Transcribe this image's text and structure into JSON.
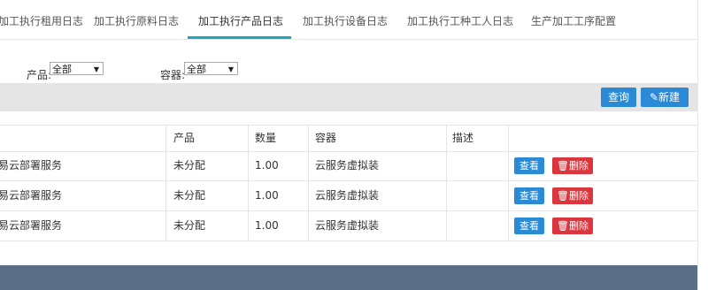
{
  "tabs": [
    {
      "label": "加工执行租用日志"
    },
    {
      "label": "加工执行原料日志"
    },
    {
      "label": "加工执行产品日志"
    },
    {
      "label": "加工执行设备日志"
    },
    {
      "label": "加工执行工种工人日志"
    },
    {
      "label": "生产加工工序配置"
    }
  ],
  "active_tab": "加工执行产品日志",
  "filters": {
    "product_label": "产品:",
    "product_value": "全部",
    "container_label": "容器:",
    "container_value": "全部"
  },
  "toolbar": {
    "query_label": "查询",
    "new_label": "新建"
  },
  "table": {
    "headers": [
      "",
      "产品",
      "数量",
      "容器",
      "描述",
      ""
    ],
    "rows": [
      {
        "name": "易云部署服务",
        "product": "未分配",
        "qty": "1.00",
        "container": "云服务虚拟装",
        "desc": "",
        "view": "查看",
        "delete": "删除"
      },
      {
        "name": "易云部署服务",
        "product": "未分配",
        "qty": "1.00",
        "container": "云服务虚拟装",
        "desc": "",
        "view": "查看",
        "delete": "删除"
      },
      {
        "name": "易云部署服务",
        "product": "未分配",
        "qty": "1.00",
        "container": "云服务虚拟装",
        "desc": "",
        "view": "查看",
        "delete": "删除"
      }
    ]
  },
  "colors": {
    "accent": "#1fa6b8",
    "button_blue": "#2a8ad5",
    "button_red": "#d9363e",
    "footer": "#5a6e88"
  }
}
